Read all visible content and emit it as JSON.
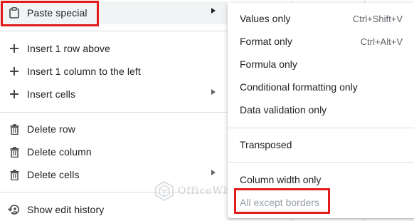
{
  "main_menu": {
    "items": [
      {
        "id": "paste-special",
        "label": "Paste special",
        "icon": "clipboard-icon",
        "submenu": true
      },
      {
        "id": "insert-row-above",
        "label": "Insert 1 row above",
        "icon": "plus-icon",
        "submenu": false
      },
      {
        "id": "insert-column-left",
        "label": "Insert 1 column to the left",
        "icon": "plus-icon",
        "submenu": false
      },
      {
        "id": "insert-cells",
        "label": "Insert cells",
        "icon": "plus-icon",
        "submenu": true
      },
      {
        "id": "delete-row",
        "label": "Delete row",
        "icon": "trash-icon",
        "submenu": false
      },
      {
        "id": "delete-column",
        "label": "Delete column",
        "icon": "trash-icon",
        "submenu": false
      },
      {
        "id": "delete-cells",
        "label": "Delete cells",
        "icon": "trash-icon",
        "submenu": true
      },
      {
        "id": "show-edit-history",
        "label": "Show edit history",
        "icon": "history-icon",
        "submenu": false
      }
    ]
  },
  "sub_menu": {
    "items": [
      {
        "id": "values-only",
        "label": "Values only",
        "shortcut": "Ctrl+Shift+V"
      },
      {
        "id": "format-only",
        "label": "Format only",
        "shortcut": "Ctrl+Alt+V"
      },
      {
        "id": "formula-only",
        "label": "Formula only"
      },
      {
        "id": "conditional-formatting-only",
        "label": "Conditional formatting only"
      },
      {
        "id": "data-validation-only",
        "label": "Data validation only"
      },
      {
        "id": "transposed",
        "label": "Transposed"
      },
      {
        "id": "column-width-only",
        "label": "Column width only"
      },
      {
        "id": "all-except-borders",
        "label": "All except borders"
      }
    ]
  },
  "watermark": {
    "text": "OfficeWheel"
  },
  "colors": {
    "callout": "#e21b1b",
    "hover": "#f1f3f4",
    "separator": "#dadce0"
  }
}
